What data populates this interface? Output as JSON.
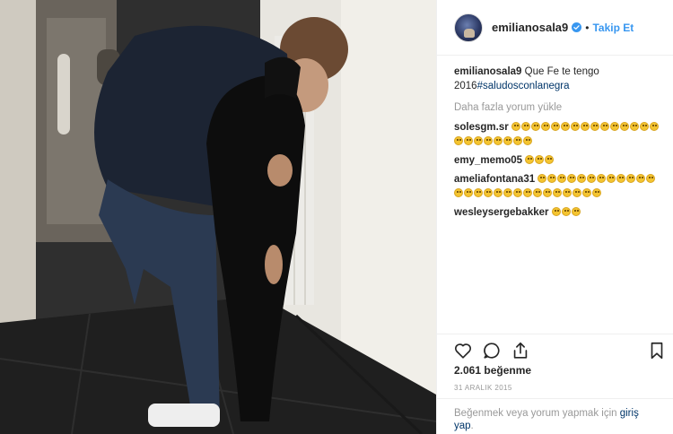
{
  "post": {
    "username": "emilianosala9",
    "follow_label": "Takip Et",
    "dot": "•",
    "caption_text": "Que Fe te tengo 2016",
    "caption_hashtag": "#saludosconlanegra",
    "load_more": "Daha fazla yorum yükle",
    "likes": "2.061 beğenme",
    "date": "31 ARALIK 2015",
    "login_text": "Beğenmek veya yorum yapmak için",
    "login_link": "giriş yap",
    "login_end": "."
  },
  "comments": [
    {
      "user": "solesgm.sr",
      "emoji_count": 23,
      "emoji": "crying-face"
    },
    {
      "user": "emy_memo05",
      "emoji_count": 3,
      "emoji": "smiling-face"
    },
    {
      "user": "ameliafontana31",
      "emoji_count": 27,
      "emoji": "smiling-face"
    },
    {
      "user": "wesleysergebakker",
      "emoji_count": 3,
      "emoji": "crying-face"
    }
  ],
  "icons": [
    "verified-badge-icon",
    "heart-icon",
    "comment-icon",
    "share-icon",
    "bookmark-icon"
  ],
  "colors": {
    "link_blue": "#3897f0",
    "hashtag": "#003569",
    "muted": "#999999",
    "border": "#efefef"
  }
}
